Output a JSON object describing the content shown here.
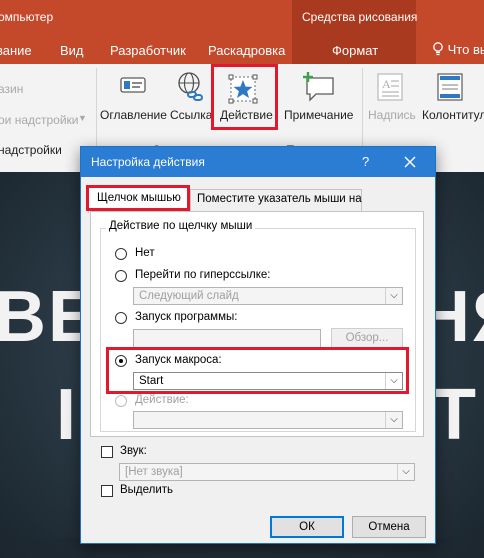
{
  "ribbon": {
    "title_fragment": "омпьютер",
    "context_group_label": "Средства рисования",
    "tabs": [
      {
        "label": "вание"
      },
      {
        "label": "Вид"
      },
      {
        "label": "Разработчик"
      },
      {
        "label": "Раскадровка"
      },
      {
        "label": "Формат"
      },
      {
        "label": "Что вы"
      }
    ],
    "left_items": [
      {
        "label": "азин"
      },
      {
        "label": "ои надстройки"
      },
      {
        "label": "надстройки"
      }
    ],
    "buttons": [
      {
        "label": "Оглавление",
        "icon": "table-of-contents-icon"
      },
      {
        "label": "Ссылка",
        "icon": "link-globe-icon"
      },
      {
        "label": "Действие",
        "icon": "action-star-icon"
      },
      {
        "label": "Примечание",
        "icon": "comment-icon"
      },
      {
        "label": "Надпись",
        "icon": "text-box-icon"
      },
      {
        "label": "Колонтитулы",
        "icon": "header-footer-icon"
      }
    ],
    "group_fragment": "С",
    "group_fragment_2": "П"
  },
  "slide": {
    "word_left": "ВЕР",
    "word_right": "НЯ",
    "word_left_2": "I",
    "word_right_2": "Т"
  },
  "dialog": {
    "title": "Настройка действия",
    "help_label": "?",
    "tabs": [
      {
        "label": "Щелчок мышью",
        "active": true
      },
      {
        "label": "Поместите указатель мыши на",
        "active": false
      }
    ],
    "group_label": "Действие по щелчку мыши",
    "options": {
      "none": {
        "label": "Нет",
        "selected": false
      },
      "hyperlink": {
        "label": "Перейти по гиперссылке:",
        "selected": false,
        "value": "Следующий слайд"
      },
      "run_program": {
        "label": "Запуск программы:",
        "selected": false,
        "value": "",
        "browse_label": "Обзор..."
      },
      "run_macro": {
        "label": "Запуск макроса:",
        "selected": true,
        "value": "Start"
      },
      "object_action": {
        "label": "Действие:",
        "selected": false,
        "value": ""
      }
    },
    "sound": {
      "label": "Звук:",
      "checked": false,
      "value": "[Нет звука]"
    },
    "highlight": {
      "label": "Выделить",
      "checked": false
    },
    "ok_label": "ОК",
    "cancel_label": "Отмена"
  },
  "colors": {
    "accent_red": "#c4492a",
    "dialog_blue": "#2b7cd3",
    "highlight_red": "#e2192c"
  }
}
